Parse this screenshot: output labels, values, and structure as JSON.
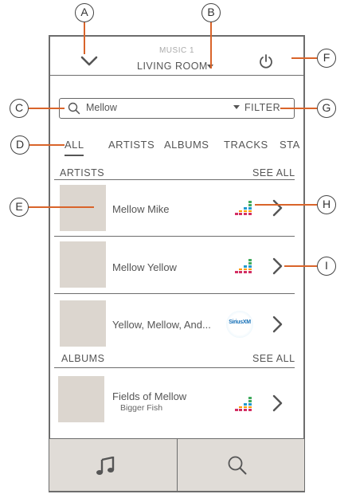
{
  "header": {
    "source_label": "MUSIC 1",
    "room_label": "LIVING ROOM"
  },
  "search": {
    "value": "Mellow",
    "filter_label": "FILTER"
  },
  "tabs": [
    "ALL",
    "ARTISTS",
    "ALBUMS",
    "TRACKS",
    "STA"
  ],
  "sections": {
    "artists_header": "ARTISTS",
    "albums_header": "ALBUMS",
    "see_all": "SEE ALL"
  },
  "artists": [
    {
      "name": "Mellow Mike",
      "service_icon": "deezer-icon"
    },
    {
      "name": "Mellow Yellow",
      "service_icon": "deezer-icon"
    },
    {
      "name": "Yellow, Mellow, And...",
      "service_icon": "siriusxm-icon",
      "service_text": "SiriusXM"
    }
  ],
  "albums": [
    {
      "name": "Fields of Mellow",
      "artist": "Bigger Fish",
      "service_icon": "deezer-icon"
    }
  ],
  "bottom_nav": [
    {
      "icon": "music-note-icon"
    },
    {
      "icon": "search-icon"
    }
  ],
  "callouts": [
    "A",
    "B",
    "C",
    "D",
    "E",
    "F",
    "G",
    "H",
    "I"
  ],
  "colors": {
    "callout_line": "#d9642a",
    "thumbnail": "#dcd6cf",
    "bottom_nav_bg": "#e0dcd7"
  }
}
